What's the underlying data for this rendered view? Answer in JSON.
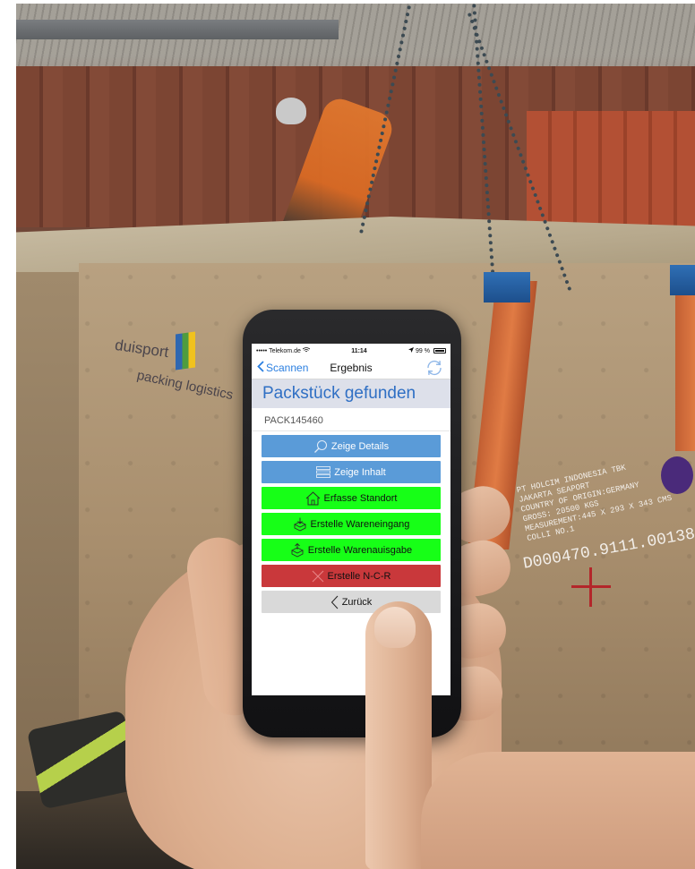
{
  "background": {
    "crate_logo_brand": "duisport",
    "crate_logo_sub": "packing logistics",
    "crate_stencil_lines": [
      "PT HOLCIM INDONESIA TBK",
      "JAKARTA SEAPORT",
      "COUNTRY OF ORIGIN:GERMANY",
      "GROSS: 20500 KGS",
      "MEASUREMENT:445 X 293 X 343 CMS",
      "COLLI NO.1"
    ],
    "crate_code": "D000470.9111.00138"
  },
  "status_bar": {
    "carrier": "••••• Telekom.de",
    "time": "11:14",
    "battery": "99 %"
  },
  "nav": {
    "back_label": "Scannen",
    "title": "Ergebnis"
  },
  "header": {
    "title": "Packstück gefunden"
  },
  "package_id": "PACK145460",
  "actions": {
    "show_details": "Zeige Details",
    "show_contents": "Zeige Inhalt",
    "record_location": "Erfasse Standort",
    "create_goods_receipt": "Erstelle Wareneingang",
    "create_goods_issue": "Erstelle Warenauisgabe",
    "create_ncr": "Erstelle N-C-R",
    "back": "Zurück"
  },
  "colors": {
    "accent_blue": "#2f6fc4",
    "button_blue": "#5a9bd8",
    "button_green": "#17ff17",
    "button_red": "#c9383b",
    "button_grey": "#d9d9d9"
  },
  "icons": {
    "details": "search-icon",
    "contents": "list-icon",
    "location": "home-icon",
    "receipt": "box-in-icon",
    "issue": "box-out-icon",
    "ncr": "cross-icon",
    "back": "chevron-left-icon",
    "nav_back": "chevron-left-icon",
    "refresh": "refresh-icon"
  }
}
